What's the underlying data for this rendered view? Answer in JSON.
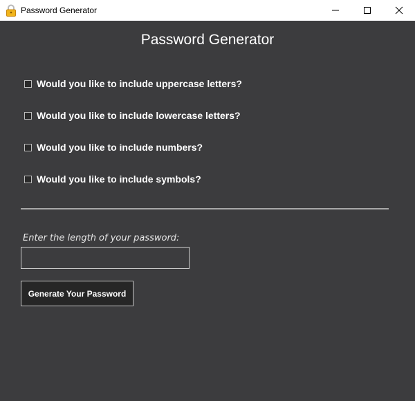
{
  "window": {
    "title": "Password Generator",
    "icon": "padlock-icon",
    "controls": [
      "minimize-icon",
      "maximize-icon",
      "close-icon"
    ]
  },
  "main": {
    "heading": "Password Generator",
    "options": [
      {
        "label": "Would you like to include uppercase letters?",
        "checked": false
      },
      {
        "label": "Would you like to include lowercase letters?",
        "checked": false
      },
      {
        "label": "Would you like to include numbers?",
        "checked": false
      },
      {
        "label": "Would you like to include symbols?",
        "checked": false
      }
    ],
    "length_label": "Enter the length of your password:",
    "length_value": "",
    "generate_button": "Generate Your Password"
  },
  "colors": {
    "background": "#3c3c3e",
    "titlebar": "#ffffff",
    "button_background": "#262626",
    "text": "#ffffff"
  }
}
